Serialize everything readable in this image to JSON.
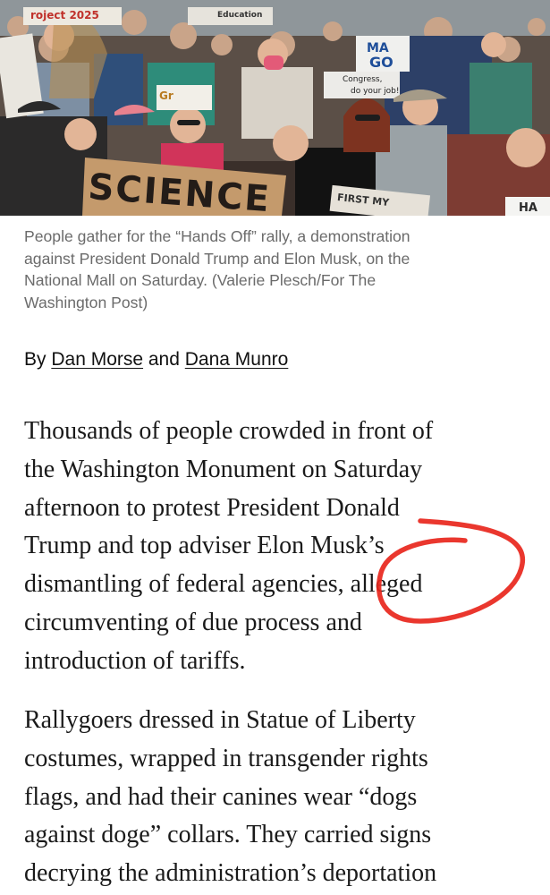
{
  "photo": {
    "signs": {
      "project": "roject 2025",
      "education": "Education",
      "ma": "MA",
      "go": "GO",
      "congress": "Congress,",
      "job": "do your job!",
      "gr": "Gr",
      "science": "SCIENCE",
      "first": "FIRST MY",
      "ha": "HA"
    }
  },
  "caption": {
    "lines": [
      "People gather for the “Hands Off” rally, a demonstration",
      "against President Donald Trump and Elon Musk,  on the",
      "National Mall on Saturday. (Valerie Plesch/For The",
      "Washington Post)"
    ]
  },
  "byline": {
    "prefix": "By ",
    "author1": "Dan Morse",
    "joiner": " and ",
    "author2": "Dana Munro"
  },
  "article": {
    "paragraph1": [
      "Thousands of people crowded in front of",
      "the Washington Monument on Saturday",
      "afternoon to protest President Donald",
      "Trump and top adviser Elon Musk’s",
      "dismantling of federal agencies, alleged",
      "circumventing of due process and",
      "introduction of tariffs."
    ],
    "paragraph2": [
      "Rallygoers dressed in Statue of Liberty",
      "costumes, wrapped in transgender rights",
      "flags, and had their canines wear “dogs",
      "against doge” collars. They carried signs",
      "decrying the administration’s deportation"
    ]
  },
  "colors": {
    "caption_gray": "#6b6b6b",
    "annotation_red": "#e8261c",
    "text": "#1a1a1a"
  }
}
